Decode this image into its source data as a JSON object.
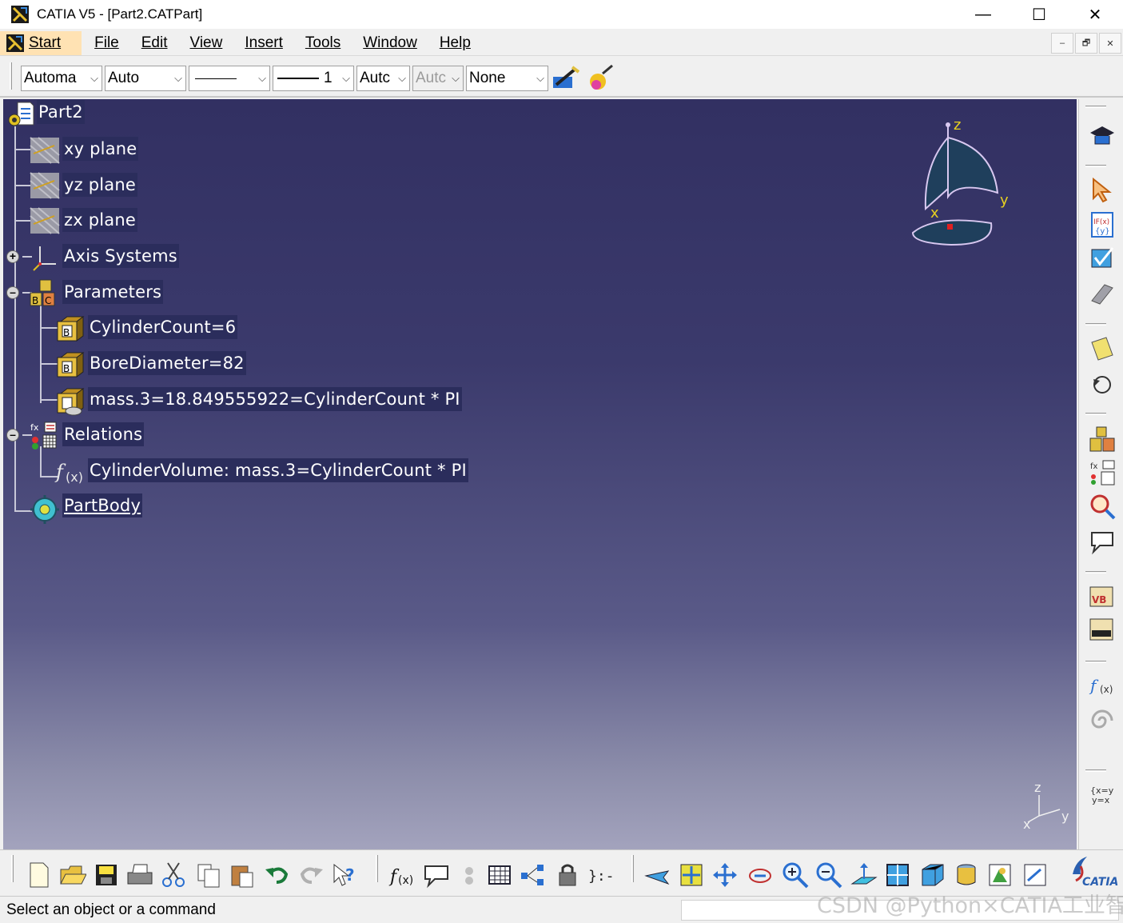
{
  "window": {
    "title": "CATIA V5 - [Part2.CATPart]",
    "minimize": "—",
    "maximize": "☐",
    "close": "✕"
  },
  "menu": {
    "start": "Start",
    "items": [
      "File",
      "Edit",
      "View",
      "Insert",
      "Tools",
      "Window",
      "Help"
    ],
    "mdi": [
      "–",
      "🗗",
      "✕"
    ]
  },
  "properties_toolbar": {
    "color": "Automa",
    "transparency": "Auto",
    "linetype_arrow": "⌵",
    "linewidth_value": "1",
    "point": "Autc",
    "layer_disabled": "Autc",
    "layer": "None"
  },
  "tree": {
    "root": "Part2",
    "planes": [
      "xy plane",
      "yz plane",
      "zx plane"
    ],
    "axis_systems": "Axis Systems",
    "parameters": "Parameters",
    "parameter_items": [
      "CylinderCount=6",
      "BoreDiameter=82",
      "mass.3=18.849555922=CylinderCount * PI"
    ],
    "relations": "Relations",
    "relation_items": [
      "CylinderVolume: mass.3=CylinderCount * PI"
    ],
    "part_body": "PartBody"
  },
  "compass": {
    "z": "z",
    "y": "y",
    "x": "x"
  },
  "mini_axis": {
    "z": "z",
    "y": "y",
    "x": "x"
  },
  "colors": {
    "viewport_top": "#323062",
    "viewport_bottom": "#a3a3bd",
    "tree_label_bg": "#2b2d5c",
    "start_highlight": "#ffe2b3"
  },
  "status": {
    "message": "Select an object or a command",
    "watermark": "CSDN @Python×CATIA工业智造"
  }
}
